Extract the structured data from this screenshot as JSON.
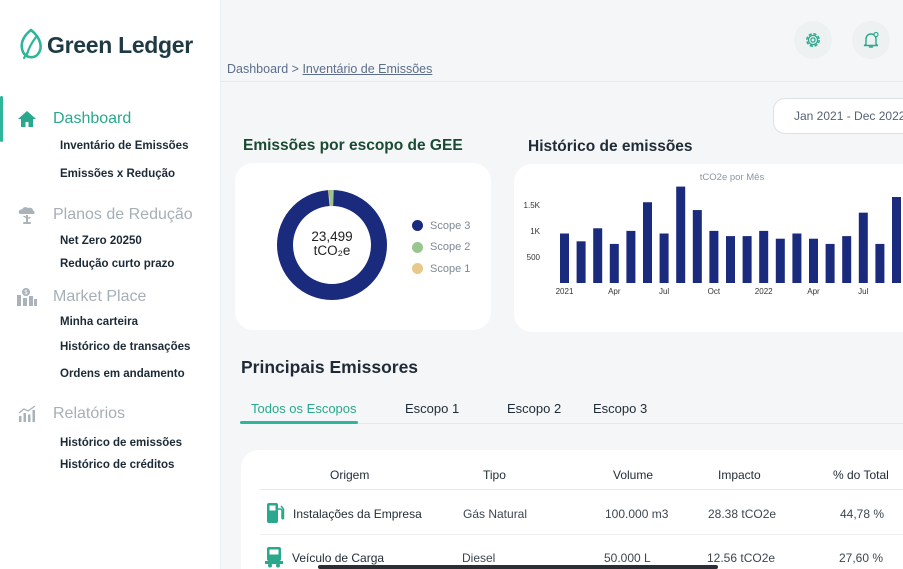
{
  "brand": {
    "name": "Green Ledger"
  },
  "sidebar": {
    "groups": [
      {
        "label": "Dashboard",
        "icon": "home-icon",
        "active": true,
        "items": [
          {
            "label": "Inventário de Emissões"
          },
          {
            "label": "Emissões x Redução"
          }
        ]
      },
      {
        "label": "Planos de Redução",
        "icon": "cloud-plant-icon",
        "active": false,
        "items": [
          {
            "label": "Net Zero 20250"
          },
          {
            "label": "Redução curto prazo"
          }
        ]
      },
      {
        "label": "Market Place",
        "icon": "marketplace-icon",
        "active": false,
        "items": [
          {
            "label": "Minha carteira"
          },
          {
            "label": "Histórico de transações"
          },
          {
            "label": "Ordens em andamento"
          }
        ]
      },
      {
        "label": "Relatórios",
        "icon": "report-chart-icon",
        "active": false,
        "items": [
          {
            "label": "Histórico de emissões"
          },
          {
            "label": "Histórico de créditos"
          }
        ]
      }
    ]
  },
  "header": {
    "breadcrumb_root": "Dashboard",
    "breadcrumb_sep": ">",
    "breadcrumb_current": "Inventário de Emissões",
    "date_range": "Jan 2021 - Dec 2022",
    "settings_icon": "gear-icon",
    "notifications_icon": "bell-icon"
  },
  "scope_panel": {
    "title": "Emissões  por escopo de GEE",
    "center_value": "23,499",
    "center_unit": "tCO₂e",
    "legend": [
      {
        "label": "Scope 3",
        "color": "#1a2a7c"
      },
      {
        "label": "Scope 2",
        "color": "#9bc58f"
      },
      {
        "label": "Scope 1",
        "color": "#e8c98a"
      }
    ]
  },
  "history_panel": {
    "title": "Histórico de emissões"
  },
  "chart_data": {
    "type": "bar",
    "title": "tCO2e por Mês",
    "categories": [
      "2021-01",
      "2021-02",
      "2021-03",
      "2021-04",
      "2021-05",
      "2021-06",
      "2021-07",
      "2021-08",
      "2021-09",
      "2021-10",
      "2021-11",
      "2021-12",
      "2022-01",
      "2022-02",
      "2022-03",
      "2022-04",
      "2022-05",
      "2022-06",
      "2022-07",
      "2022-08",
      "2022-09"
    ],
    "series": [
      {
        "values": [
          950,
          800,
          1050,
          750,
          1000,
          1550,
          950,
          1850,
          1400,
          1000,
          900,
          900,
          1000,
          850,
          950,
          850,
          750,
          900,
          1350,
          750,
          1650
        ]
      }
    ],
    "ylim": [
      0,
      1900
    ],
    "y_ticks": [
      {
        "value": 1500,
        "label": "1.5K"
      },
      {
        "value": 1000,
        "label": "1K"
      },
      {
        "value": 500,
        "label": "500"
      }
    ],
    "x_ticks": [
      {
        "index": 0,
        "label": "2021"
      },
      {
        "index": 3,
        "label": "Apr"
      },
      {
        "index": 6,
        "label": "Jul"
      },
      {
        "index": 9,
        "label": "Oct"
      },
      {
        "index": 12,
        "label": "2022"
      },
      {
        "index": 15,
        "label": "Apr"
      },
      {
        "index": 18,
        "label": "Jul"
      }
    ],
    "bar_color": "#1a2a7c",
    "grid": false
  },
  "emitters": {
    "title": "Principais Emissores",
    "tabs": [
      {
        "label": "Todos os Escopos"
      },
      {
        "label": "Escopo 1"
      },
      {
        "label": "Escopo 2"
      },
      {
        "label": "Escopo 3"
      }
    ],
    "columns": [
      "Origem",
      "Tipo",
      "Volume",
      "Impacto",
      "% do Total"
    ],
    "rows": [
      {
        "icon": "fuel-pump-icon",
        "origem": "Instalações da Empresa",
        "tipo": "Gás Natural",
        "volume": "100.000 m3",
        "impacto": "28.38 tCO2e",
        "pct": "44,78 %"
      },
      {
        "icon": "truck-icon",
        "origem": "Veículo de Carga",
        "tipo": "Diesel",
        "volume": "50.000 L",
        "impacto": "12.56 tCO2e",
        "pct": "27,60 %"
      }
    ]
  },
  "colors": {
    "accent": "#2aa88d",
    "navy": "#1a2a7c"
  }
}
